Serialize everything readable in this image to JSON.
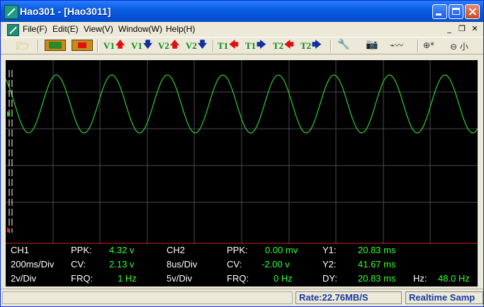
{
  "window": {
    "title": "Hao301 - [Hao3011]"
  },
  "menu": [
    "File(F)",
    "Edit(E)",
    "View(V)",
    "Window(W)",
    "Help(H)"
  ],
  "toolbar": {
    "cursors": [
      {
        "label": "V1",
        "arrow": "up"
      },
      {
        "label": "V1",
        "arrow": "down"
      },
      {
        "label": "V2",
        "arrow": "up"
      },
      {
        "label": "V2",
        "arrow": "down"
      },
      {
        "label": "T1",
        "arrow": "left"
      },
      {
        "label": "T1",
        "arrow": "right"
      },
      {
        "label": "T2",
        "arrow": "left"
      },
      {
        "label": "T2",
        "arrow": "right"
      }
    ],
    "zoom_in_glyph": "⊕*",
    "zoom_out_glyph": "⊖ 小"
  },
  "scope": {
    "colors": {
      "background": "#000000",
      "grid": "#4a4a4a",
      "trace": "#33cc33",
      "divider": "#cc2222"
    },
    "trace": {
      "cycles": 8.5
    }
  },
  "readout": {
    "ch1": {
      "name": "CH1",
      "timebase": "200ms/Div",
      "vdiv": "2v/Div",
      "ppk_label": "PPK:",
      "ppk": "4.32 v",
      "cv_label": "CV:",
      "cv": "2.13 v",
      "frq_label": "FRQ:",
      "frq": "1 Hz"
    },
    "ch2": {
      "name": "CH2",
      "timebase": "8us/Div",
      "vdiv": "5v/Div",
      "ppk_label": "PPK:",
      "ppk": "0.00 mv",
      "cv_label": "CV:",
      "cv": "-2.00 v",
      "frq_label": "FRQ:",
      "frq": "0 Hz"
    },
    "cursor": {
      "y1_label": "Y1:",
      "y1": "20.83 ms",
      "y2_label": "Y2:",
      "y2": "41.67 ms",
      "dy_label": "DY:",
      "dy": "20.83 ms",
      "hz_label": "Hz:",
      "hz": "48.0 Hz"
    }
  },
  "status": {
    "rate": "Rate:22.76MB/S",
    "mode": "Realtime Samp"
  }
}
